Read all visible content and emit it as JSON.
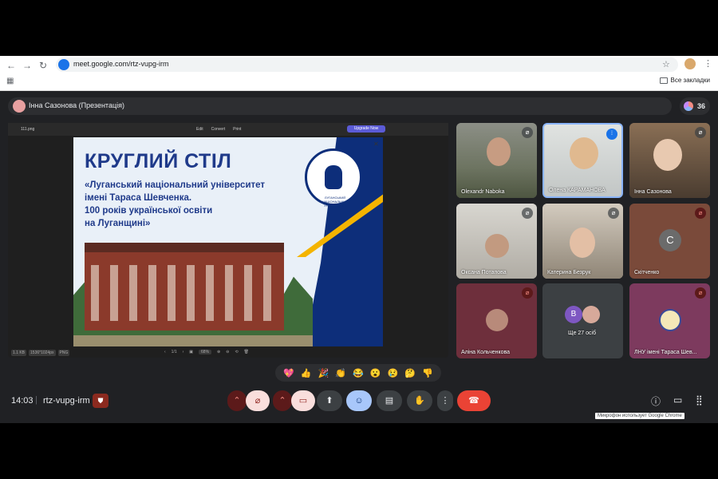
{
  "browser": {
    "url": "meet.google.com/rtz-vupg-irm",
    "bookmarks_label": "Все закладки"
  },
  "presenter": {
    "name": "Інна Сазонова (Презентація)"
  },
  "participants_count": "36",
  "presentation": {
    "filename": "111.png",
    "toolbar": [
      "Edit",
      "Convert",
      "Print"
    ],
    "upgrade_label": "Upgrade Now",
    "slide": {
      "title": "КРУГЛИЙ СТІЛ",
      "subtitle_lines": [
        "«Луганський національний університет",
        "імені Тараса Шевченка.",
        "100 років української освіти",
        "на Луганщині»"
      ],
      "seal_text": "ЛУГАНСЬКИЙ НАЦІОНАЛЬНИЙ УНІВЕРСИТЕТ"
    },
    "bottom": {
      "file_size": "1.1 KB",
      "dimensions": "1536*1024px",
      "format": "PNG",
      "page": "1/1",
      "zoom": "68%"
    }
  },
  "tiles": [
    {
      "label": "Olexandr Naboka",
      "mic": "muted"
    },
    {
      "label": "Олена КАРАМАНОВА",
      "mic": "speaking"
    },
    {
      "label": "Інна Сазонова",
      "mic": "muted"
    },
    {
      "label": "Оксана Потапова",
      "mic": "muted"
    },
    {
      "label": "Катерина Безрук",
      "mic": "muted"
    },
    {
      "label": "Скітченко",
      "mic": "muted-red",
      "initial": "C"
    },
    {
      "label": "Аліна Кольченкова",
      "mic": "muted-red"
    },
    {
      "label": "Ще 27 осіб",
      "initial": "B"
    },
    {
      "label": "ЛНУ імені Тараса Шев...",
      "mic": "muted-red"
    }
  ],
  "reactions": [
    "💖",
    "👍",
    "🎉",
    "👏",
    "😂",
    "😮",
    "😢",
    "🤔",
    "👎"
  ],
  "bottom_bar": {
    "time": "14:03",
    "separator": "|",
    "meeting_code": "rtz-vupg-irm",
    "tooltip": "Микрофон использует Google Chrome"
  },
  "colors": {
    "background": "#202124",
    "end_call": "#ea4335",
    "accent_blue": "#a8c7fa",
    "muted_red": "#5c1a1a"
  }
}
